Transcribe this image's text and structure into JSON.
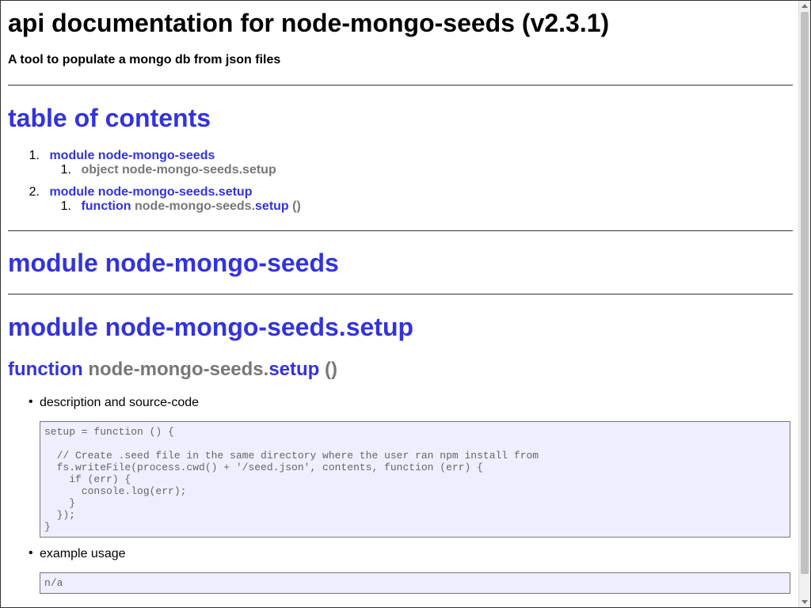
{
  "header": {
    "title": "api documentation for node-mongo-seeds (v2.3.1)",
    "subtitle": "A tool to populate a mongo db from json files"
  },
  "toc": {
    "title": "table of contents",
    "items": [
      {
        "num": "1.",
        "kind": "module",
        "name": "node-mongo-seeds",
        "children": [
          {
            "num": "1.",
            "kind": "object",
            "name": "node-mongo-seeds.setup"
          }
        ]
      },
      {
        "num": "2.",
        "kind": "module",
        "name": "node-mongo-seeds.setup",
        "children": [
          {
            "num": "1.",
            "kind": "function",
            "prefix": "node-mongo-seeds.",
            "name": "setup",
            "args": "()"
          }
        ]
      }
    ]
  },
  "sections": {
    "module1": {
      "kind": "module",
      "name": "node-mongo-seeds"
    },
    "module2": {
      "kind": "module",
      "name": "node-mongo-seeds.setup"
    },
    "function": {
      "kind": "function",
      "prefix": "node-mongo-seeds.",
      "name": "setup",
      "args": "()"
    }
  },
  "details": {
    "description_label": "description and source-code",
    "source_code": "setup = function () {\n\n  // Create .seed file in the same directory where the user ran npm install from\n  fs.writeFile(process.cwd() + '/seed.json', contents, function (err) {\n    if (err) {\n      console.log(err);\n    }\n  });\n}",
    "example_label": "example usage",
    "example_code": "n/a"
  },
  "colors": {
    "link": "#3333dd",
    "muted": "#777777",
    "code_bg": "#eeeeff"
  }
}
